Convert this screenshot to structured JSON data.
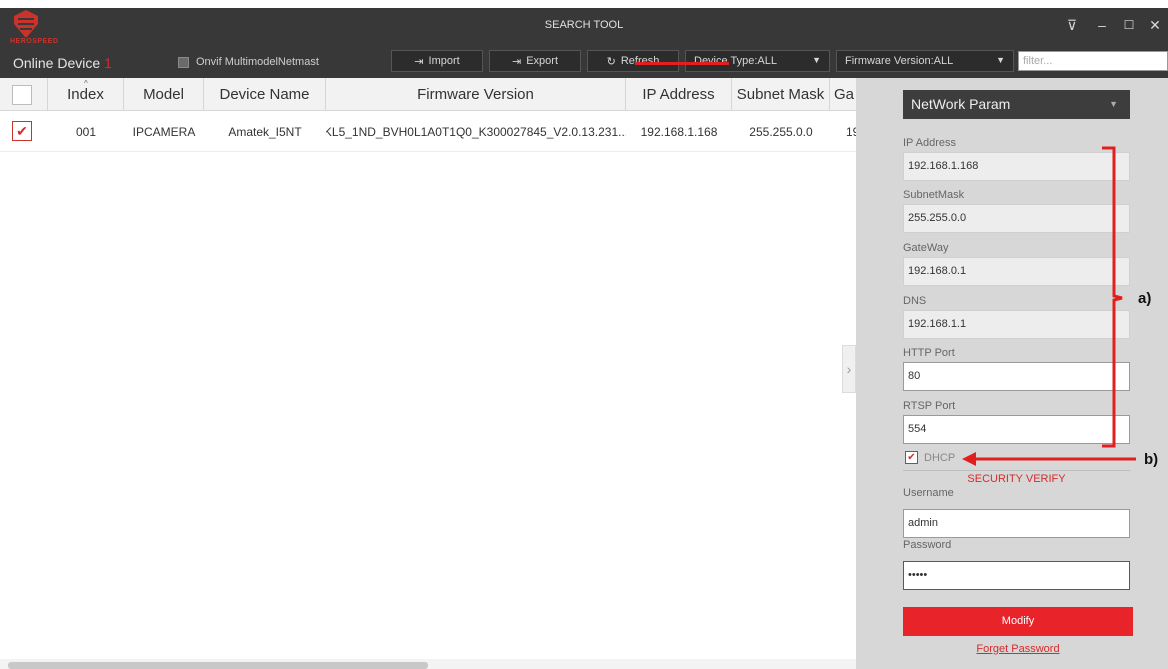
{
  "window": {
    "title": "SEARCH TOOL",
    "brand": "HEROSPEED"
  },
  "toolbar": {
    "online_label": "Online Device",
    "online_count": "1",
    "onvif_label": "Onvif MultimodelNetmast",
    "import_label": "Import",
    "export_label": "Export",
    "refresh_label": "Refresh",
    "device_type": "Device Type:ALL",
    "firmware_version": "Firmware Version:ALL",
    "filter_placeholder": "filter..."
  },
  "table": {
    "columns": [
      "Index",
      "Model",
      "Device Name",
      "Firmware Version",
      "IP Address",
      "Subnet Mask",
      "Ga"
    ],
    "rows": [
      {
        "index": "001",
        "model": "IPCAMERA",
        "device_name": "Amatek_I5NT",
        "firmware": "KL5_1ND_BVH0L1A0T1Q0_K300027845_V2.0.13.231...",
        "ip": "192.168.1.168",
        "subnet": "255.255.0.0",
        "gateway": "19"
      }
    ]
  },
  "panel": {
    "mode": "NetWork Param",
    "ip_label": "IP Address",
    "ip_value": "192.168.1.168",
    "subnet_label": "SubnetMask",
    "subnet_value": "255.255.0.0",
    "gateway_label": "GateWay",
    "gateway_value": "192.168.0.1",
    "dns_label": "DNS",
    "dns_value": "192.168.1.1",
    "http_label": "HTTP Port",
    "http_value": "80",
    "rtsp_label": "RTSP Port",
    "rtsp_value": "554",
    "dhcp_label": "DHCP",
    "security_label": "SECURITY VERIFY",
    "username_label": "Username",
    "username_value": "admin",
    "password_label": "Password",
    "password_value": "•••••",
    "modify_label": "Modify",
    "forget_label": "Forget Password"
  },
  "annotations": {
    "a": "a)",
    "b": "b)"
  },
  "colors": {
    "accent_red": "#e8242a",
    "dark_bar": "#383838",
    "panel_bg": "#d7d7d7"
  }
}
